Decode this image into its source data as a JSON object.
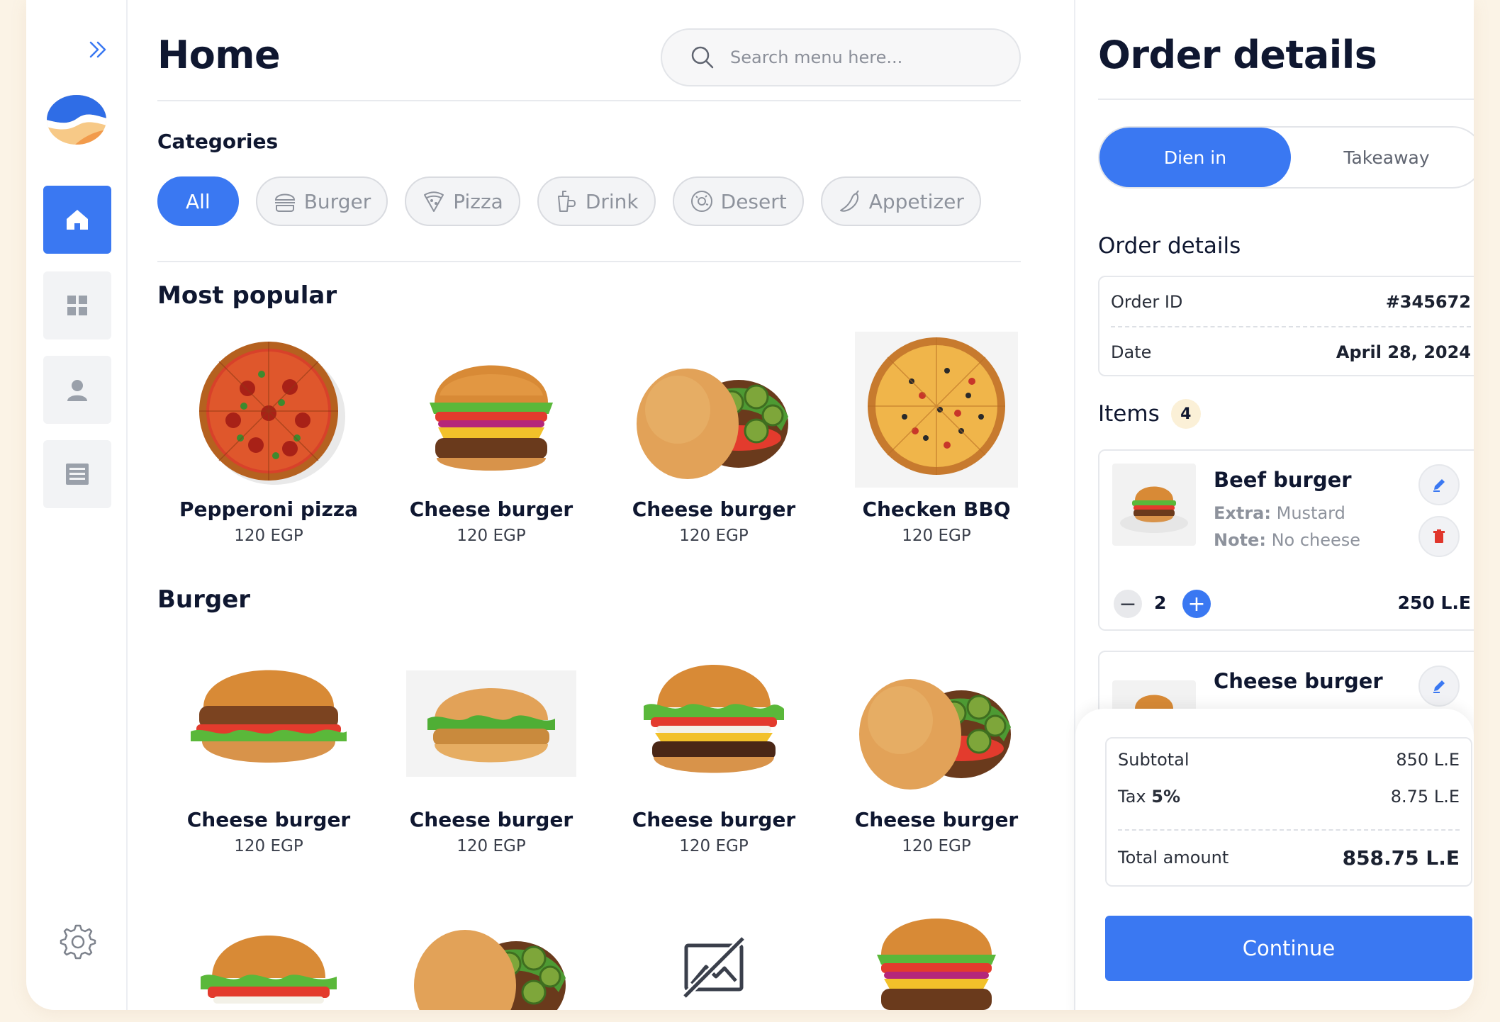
{
  "header": {
    "title": "Home",
    "search_placeholder": "Search menu here..."
  },
  "sidebar": {
    "items": [
      {
        "name": "home",
        "icon": "home-icon",
        "active": true
      },
      {
        "name": "dashboard",
        "icon": "grid-icon",
        "active": false
      },
      {
        "name": "profile",
        "icon": "user-icon",
        "active": false
      },
      {
        "name": "orders",
        "icon": "list-icon",
        "active": false
      }
    ],
    "settings_icon": "gear-icon"
  },
  "categories": {
    "label": "Categories",
    "items": [
      {
        "label": "All",
        "icon": "",
        "active": true
      },
      {
        "label": "Burger",
        "icon": "burger-icon",
        "active": false
      },
      {
        "label": "Pizza",
        "icon": "pizza-icon",
        "active": false
      },
      {
        "label": "Drink",
        "icon": "drink-icon",
        "active": false
      },
      {
        "label": "Desert",
        "icon": "donut-icon",
        "active": false
      },
      {
        "label": "Appetizer",
        "icon": "chili-icon",
        "active": false
      }
    ]
  },
  "popular": {
    "label": "Most popular",
    "items": [
      {
        "name": "Pepperoni pizza",
        "price": "120 EGP"
      },
      {
        "name": "Cheese burger",
        "price": "120 EGP"
      },
      {
        "name": "Cheese burger",
        "price": "120 EGP"
      },
      {
        "name": "Checken BBQ",
        "price": "120 EGP"
      }
    ]
  },
  "burger": {
    "label": "Burger",
    "items": [
      {
        "name": "Cheese burger",
        "price": "120 EGP"
      },
      {
        "name": "Cheese burger",
        "price": "120 EGP"
      },
      {
        "name": "Cheese burger",
        "price": "120 EGP"
      },
      {
        "name": "Cheese burger",
        "price": "120 EGP"
      }
    ]
  },
  "order": {
    "title": "Order details",
    "modes": [
      "Dien in",
      "Takeaway"
    ],
    "active_mode": "Dien in",
    "details_label": "Order details",
    "order_id_label": "Order ID",
    "order_id": "#345672",
    "date_label": "Date",
    "date": "April 28, 2024",
    "items_label": "Items",
    "items_count": "4",
    "items": [
      {
        "name": "Beef burger",
        "extra_label": "Extra:",
        "extra": "Mustard",
        "note_label": "Note:",
        "note": "No cheese",
        "qty": "2",
        "total": "250 L.E"
      },
      {
        "name": "Cheese burger"
      }
    ],
    "subtotal_label": "Subtotal",
    "subtotal": "850 L.E",
    "tax_label": "Tax",
    "tax_rate": "5%",
    "tax": "8.75 L.E",
    "total_label": "Total amount",
    "total": "858.75 L.E",
    "continue_label": "Continue"
  },
  "colors": {
    "accent": "#3a78f2",
    "text": "#0f1730",
    "page_bg": "#fbf3e6"
  }
}
